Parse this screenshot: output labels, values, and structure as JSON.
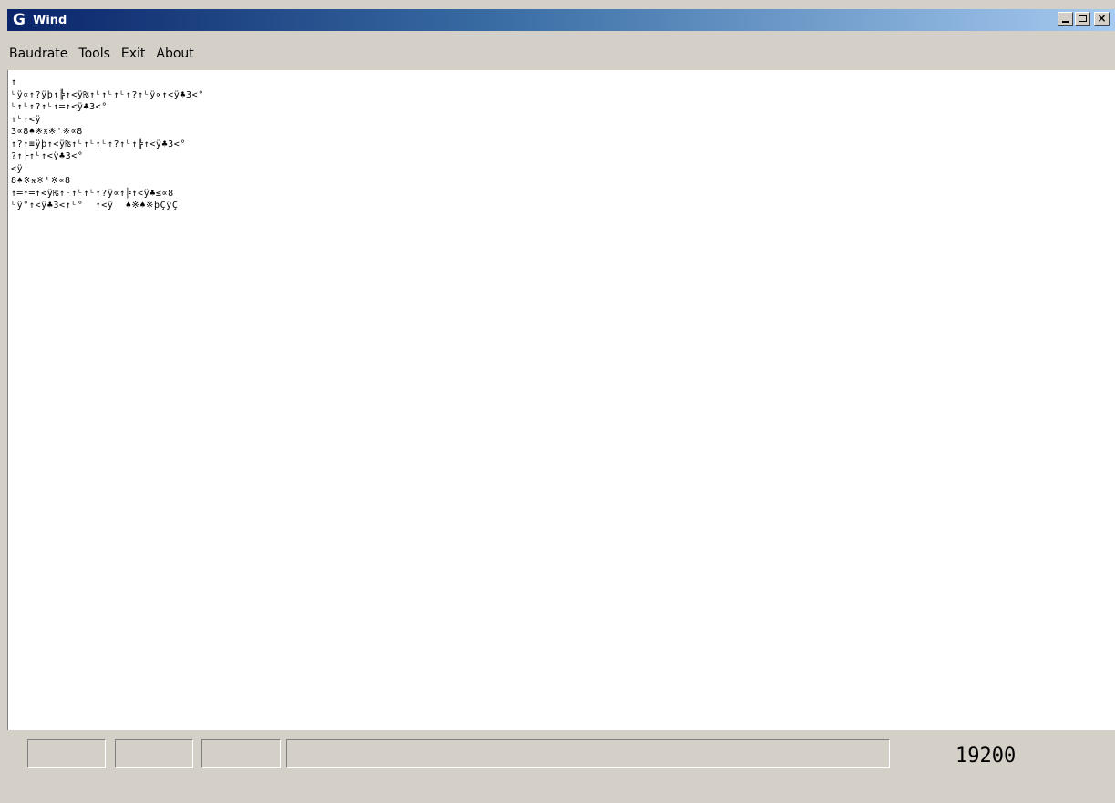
{
  "window": {
    "icon_letter": "G",
    "title": "Wind"
  },
  "caption_buttons": {
    "close_glyph": "×"
  },
  "menu": {
    "items": [
      "Baudrate",
      "Tools",
      "Exit",
      "About"
    ]
  },
  "terminal": {
    "lines": [
      "↑",
      "ᴸÿ∝↑?ÿþ↑╠↑<ÿ₨↑ᴸ↑ᴸ↑ᴸ↑?↑ᴸÿ∝↑<ÿ♣3<°",
      "ᴸ↑ᴸ↑?↑ᴸ↑═↑<ÿ♣3<°",
      "↑ᴸ↑<ÿ",
      "3∝8♠※ӿ※'※∝8",
      "↑?↑≡ÿþ↑<ÿ₨↑ᴸ↑ᴸ↑ᴸ↑?↑ᴸ↑╠↑<ÿ♣3<°",
      "?↑├↑ᴸ↑<ÿ♣3<°",
      "<ÿ",
      "8♠※ӿ※'※∝8",
      "↑═↑═↑<ÿ₨↑ᴸ↑ᴸ↑ᴸ↑?ÿ∝↑╠↑<ÿ♣≤∝8",
      "ᴸÿ°↑<ÿ♣3<↑ᴸ°  ↑<ÿ  ♠※♠※þÇÿÇ"
    ]
  },
  "status": {
    "baudrate": "19200"
  },
  "colors": {
    "titlebar_start": "#0a246a",
    "titlebar_end": "#a6caf0",
    "face": "#d4d0c8"
  }
}
